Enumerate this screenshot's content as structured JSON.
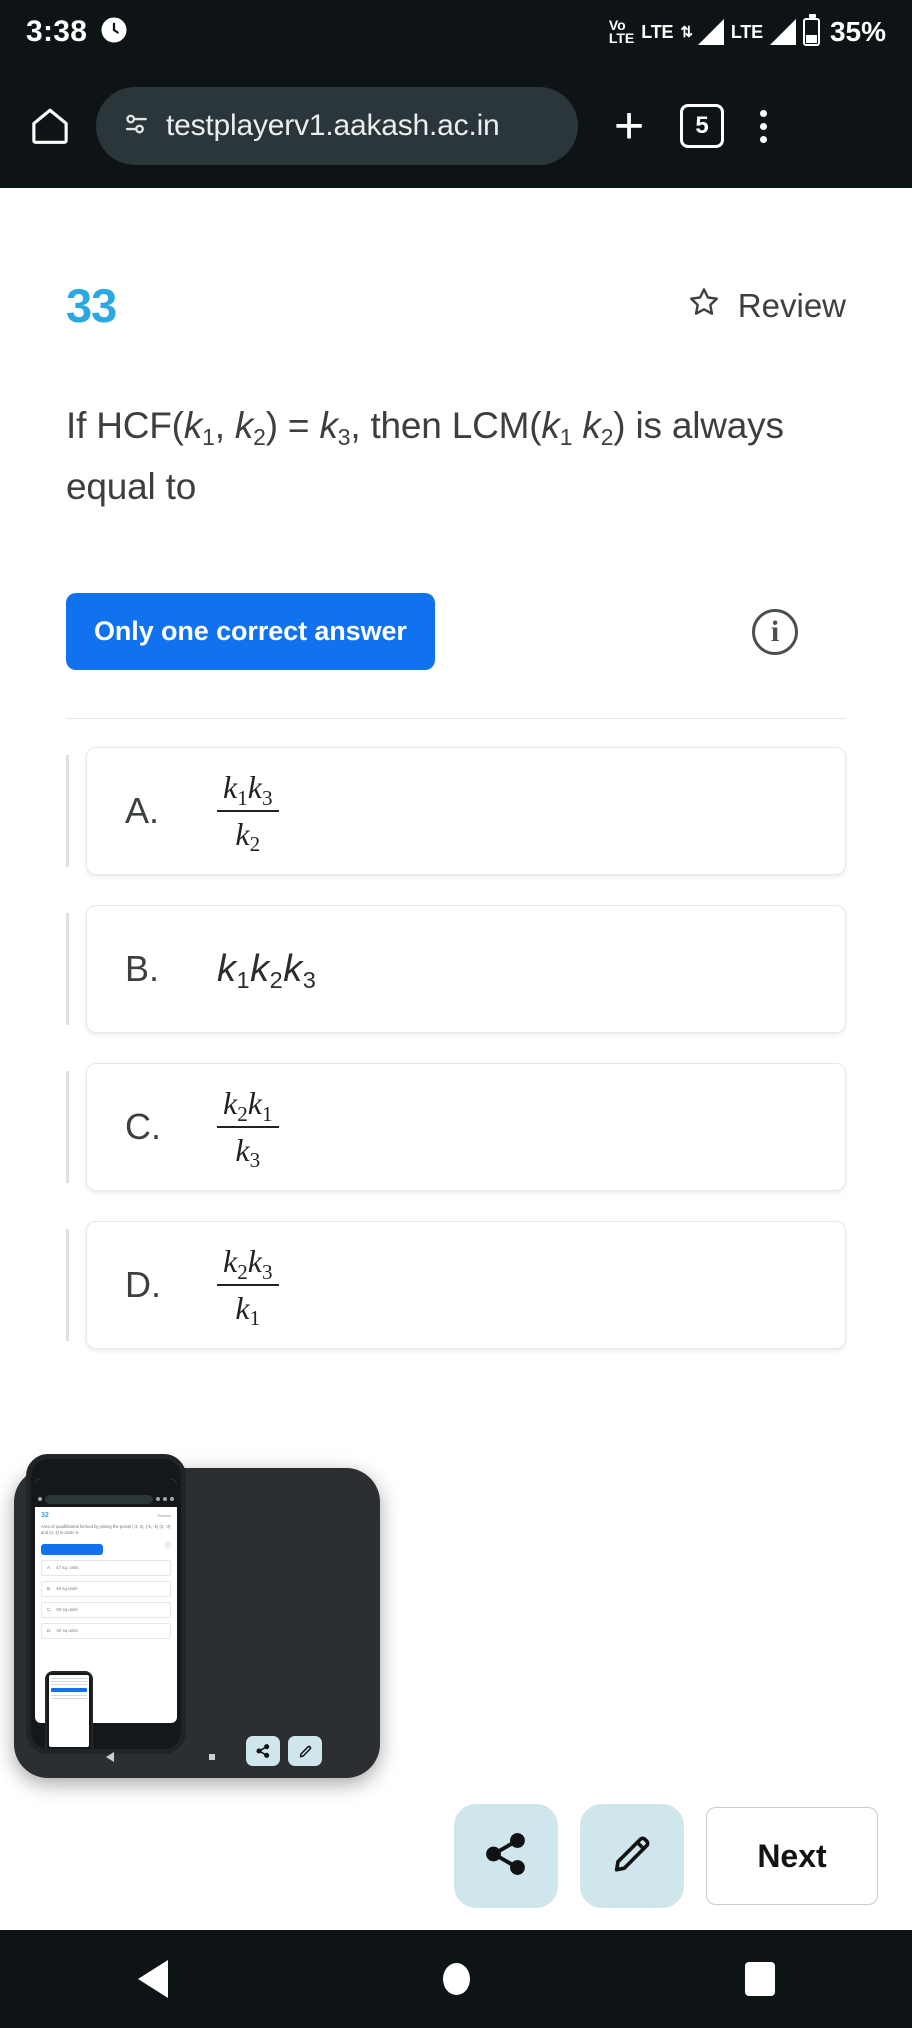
{
  "status_bar": {
    "time": "3:38",
    "alarm_icon": "clock-icon",
    "volte_top": "Vo",
    "volte_bottom": "LTE",
    "lte_label_1": "LTE",
    "lte_label_2": "LTE",
    "battery_percent": "35%"
  },
  "browser": {
    "home_icon": "home-icon",
    "lock_icon": "permissions-icon",
    "url": "testplayerv1.aakash.ac.in",
    "new_tab_icon": "plus-icon",
    "tab_count": "5",
    "menu_icon": "overflow-menu-icon"
  },
  "question": {
    "number": "33",
    "review_label": "Review",
    "review_icon": "star-outline-icon",
    "text_html": "If HCF(<i>k</i><sub>1</sub>, <i>k</i><sub>2</sub>) = <i>k</i><sub>3</sub>, then LCM(<i>k</i><sub>1</sub> <i>k</i><sub>2</sub>) is always equal to",
    "text_plain": "If HCF(k1, k2) = k3, then LCM(k1 k2) is always equal to",
    "badge_label": "Only one correct answer",
    "badge_color": "#1172f0",
    "number_color": "#2aa8e2",
    "info_icon": "info-circle-icon"
  },
  "options": [
    {
      "letter": "A.",
      "type": "fraction",
      "numerator_html": "k<sub>1</sub>k<sub>3</sub>",
      "denominator_html": "k<sub>2</sub>",
      "plain": "k1k3/k2"
    },
    {
      "letter": "B.",
      "type": "plain",
      "value_html": "k<sub>1</sub>k<sub>2</sub>k<sub>3</sub>",
      "plain": "k1k2k3"
    },
    {
      "letter": "C.",
      "type": "fraction",
      "numerator_html": "k<sub>2</sub>k<sub>1</sub>",
      "denominator_html": "k<sub>3</sub>",
      "plain": "k2k1/k3"
    },
    {
      "letter": "D.",
      "type": "fraction",
      "numerator_html": "k<sub>2</sub>k<sub>3</sub>",
      "denominator_html": "k<sub>1</sub>",
      "plain": "k2k3/k1"
    }
  ],
  "bottom_bar": {
    "share_icon": "share-icon",
    "edit_icon": "pencil-icon",
    "next_label": "Next"
  },
  "pip_overlay": {
    "label": "screen-recording-preview",
    "inner_question_number": "32",
    "inner_review_label": "Review",
    "inner_question_text": "Area of quadrilateral formed by joining the points (-3, 2), (-5, -5) (2, -3) and (4, 4) in order is",
    "inner_badge_label": "Only one correct answer",
    "inner_options": [
      {
        "letter": "A.",
        "value": "47 sq. units"
      },
      {
        "letter": "B.",
        "value": "46 sq units"
      },
      {
        "letter": "C.",
        "value": "50 sq units"
      },
      {
        "letter": "D.",
        "value": "40 sq units"
      }
    ],
    "share_icon": "share-icon",
    "edit_icon": "pencil-icon"
  },
  "android_nav": {
    "back_icon": "back-triangle-icon",
    "home_icon": "home-circle-icon",
    "recents_icon": "recents-square-icon"
  }
}
